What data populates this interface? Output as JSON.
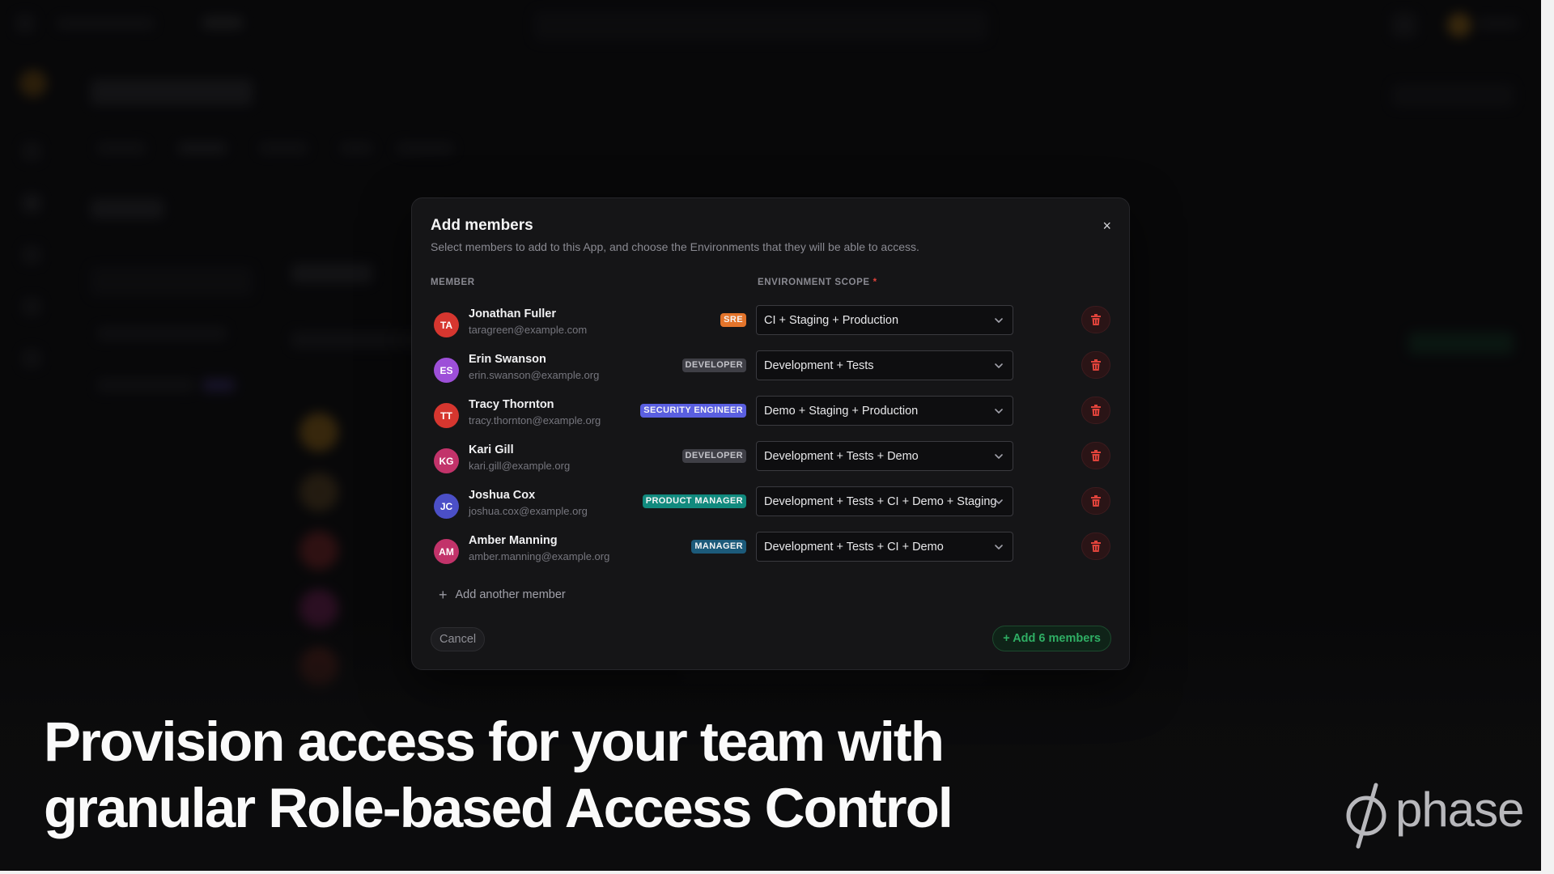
{
  "modal": {
    "title": "Add members",
    "description": "Select members to add to this App, and choose the Environments that they will be able to access.",
    "close_icon": "×",
    "member_header": "MEMBER",
    "scope_header": "ENVIRONMENT SCOPE",
    "required_mark": "*",
    "members": [
      {
        "initials": "TA",
        "name": "Jonathan Fuller",
        "email": "taragreen@example.com",
        "role": "SRE",
        "role_color": "#e3742b",
        "avatar_color": "#d6362f",
        "scope": "CI + Staging + Production"
      },
      {
        "initials": "ES",
        "name": "Erin Swanson",
        "email": "erin.swanson@example.org",
        "role": "DEVELOPER",
        "role_color": "#3f3f46",
        "avatar_color": "#9d4fd8",
        "scope": "Development + Tests"
      },
      {
        "initials": "TT",
        "name": "Tracy Thornton",
        "email": "tracy.thornton@example.org",
        "role": "SECURITY ENGINEER",
        "role_color": "#5a5fe0",
        "avatar_color": "#d6362f",
        "scope": "Demo + Staging + Production"
      },
      {
        "initials": "KG",
        "name": "Kari Gill",
        "email": "kari.gill@example.org",
        "role": "DEVELOPER",
        "role_color": "#3f3f46",
        "avatar_color": "#c2336a",
        "scope": "Development + Tests + Demo"
      },
      {
        "initials": "JC",
        "name": "Joshua Cox",
        "email": "joshua.cox@example.org",
        "role": "PRODUCT MANAGER",
        "role_color": "#118a7e",
        "avatar_color": "#4b4fc7",
        "scope": "Development + Tests + CI + Demo + Staging"
      },
      {
        "initials": "AM",
        "name": "Amber Manning",
        "email": "amber.manning@example.org",
        "role": "MANAGER",
        "role_color": "#1c5a7a",
        "avatar_color": "#c2336a",
        "scope": "Development + Tests + CI + Demo"
      }
    ],
    "add_another_label": "Add another member",
    "cancel_label": "Cancel",
    "submit_label": "+ Add 6 members"
  },
  "headline": {
    "line1": "Provision access for your team with",
    "line2": "granular Role-based Access Control"
  },
  "logo": {
    "word": "phase"
  }
}
